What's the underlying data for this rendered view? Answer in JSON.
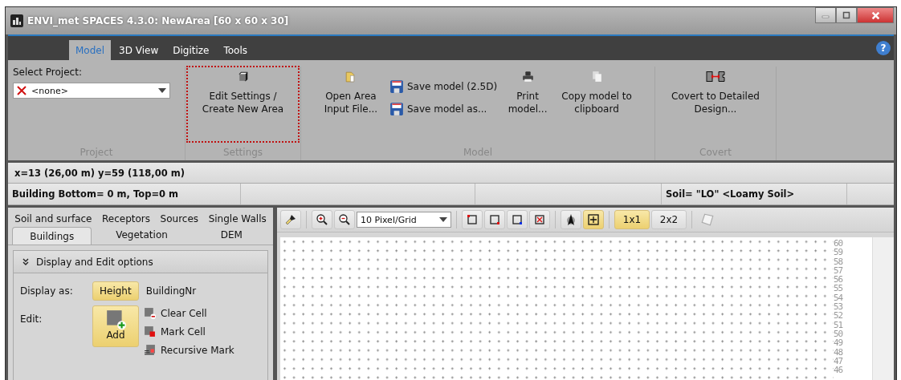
{
  "window": {
    "title": "ENVI_met SPACES 4.3.0:  NewArea [60 x 60 x 30]"
  },
  "help": "?",
  "tabs": [
    {
      "label": "Model",
      "selected": true
    },
    {
      "label": "3D View",
      "selected": false
    },
    {
      "label": "Digitize",
      "selected": false
    },
    {
      "label": "Tools",
      "selected": false
    }
  ],
  "ribbon": {
    "project": {
      "label": "Select Project:",
      "value": "<none>",
      "group": "Project"
    },
    "settings": {
      "button": "Edit Settings / Create New Area",
      "focused": true,
      "group": "Settings"
    },
    "model": {
      "group": "Model",
      "open": "Open Area Input File...",
      "save": "Save model (2.5D)",
      "save_as": "Save model as...",
      "print": "Print model...",
      "copy": "Copy model to clipboard"
    },
    "covert": {
      "group": "Covert",
      "button": "Covert to Detailed Design..."
    }
  },
  "status_bar": {
    "coordinates": "x=13 (26,00 m) y=59 (118,00 m)",
    "building": "Building Bottom= 0 m, Top=0 m",
    "soil": "Soil= \"LO\"  <Loamy Soil>"
  },
  "panel_tabs": [
    [
      {
        "label": "Soil and surface",
        "selected": false
      },
      {
        "label": "Receptors",
        "selected": false
      },
      {
        "label": "Sources",
        "selected": false
      },
      {
        "label": "Single Walls",
        "selected": false
      }
    ],
    [
      {
        "label": "Buildings",
        "selected": true
      },
      {
        "label": "Vegetation",
        "selected": false
      },
      {
        "label": "DEM",
        "selected": false
      }
    ]
  ],
  "options": {
    "title": "Display and Edit options",
    "expanded": true,
    "display_label": "Display as:",
    "display": [
      {
        "label": "Height",
        "selected": true
      },
      {
        "label": "BuildingNr",
        "selected": false
      }
    ],
    "edit_label": "Edit:",
    "add": {
      "label": "Add",
      "selected": true
    },
    "tools": [
      {
        "label": "Clear Cell",
        "kind": "clear"
      },
      {
        "label": "Mark Cell",
        "kind": "mark"
      },
      {
        "label": "Recursive Mark",
        "kind": "recursive"
      }
    ]
  },
  "toolbar": {
    "zoom": "10 Pixel/Grid",
    "grid_toggle": {
      "selected": true
    },
    "sizes": [
      {
        "label": "1x1",
        "selected": true
      },
      {
        "label": "2x2",
        "selected": false
      }
    ]
  },
  "row_labels": [
    "60",
    "59",
    "58",
    "57",
    "56",
    "55",
    "54",
    "53",
    "52",
    "51",
    "50",
    "49",
    "48",
    "47",
    "46"
  ]
}
